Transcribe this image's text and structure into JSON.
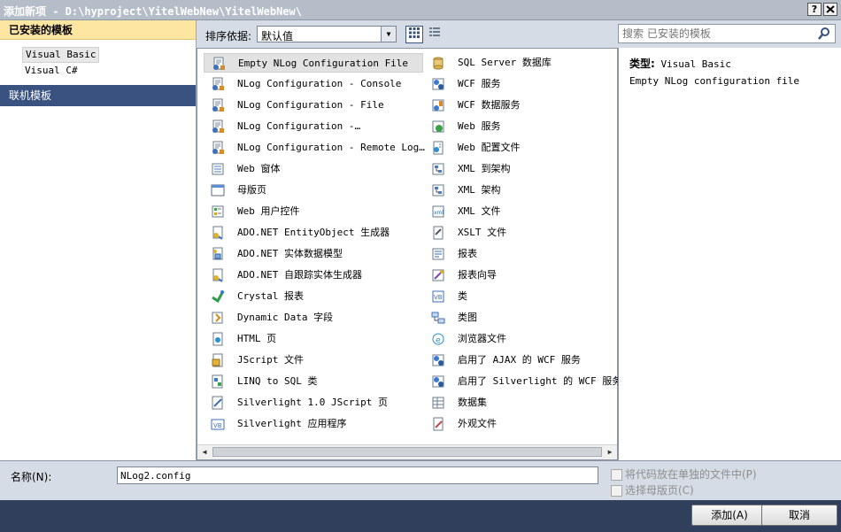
{
  "window": {
    "title": "添加新项 - D:\\hyproject\\YitelWebNew\\YitelWebNew\\",
    "help_btn": "?",
    "close_btn": "X"
  },
  "sidebar": {
    "installed_header": "已安装的模板",
    "items": [
      {
        "label": "Visual Basic",
        "selected": true
      },
      {
        "label": "Visual C#",
        "selected": false
      }
    ],
    "online_header": "联机模板"
  },
  "toolbar": {
    "sort_label": "排序依据:",
    "sort_value": "默认值",
    "search_placeholder": "搜索 已安装的模板"
  },
  "templates_left": [
    {
      "label": "Empty NLog Configuration File",
      "icon": "nlog-config-icon",
      "selected": true
    },
    {
      "label": "NLog Configuration - Console",
      "icon": "nlog-config-icon"
    },
    {
      "label": "NLog Configuration - File",
      "icon": "nlog-config-icon"
    },
    {
      "label": "NLog Configuration -…",
      "icon": "nlog-config-icon"
    },
    {
      "label": "NLog Configuration - Remote Log…",
      "icon": "nlog-config-icon"
    },
    {
      "label": "Web 窗体",
      "icon": "web-form-icon"
    },
    {
      "label": "母版页",
      "icon": "master-page-icon"
    },
    {
      "label": "Web 用户控件",
      "icon": "user-control-icon"
    },
    {
      "label": "ADO.NET EntityObject 生成器",
      "icon": "entity-generator-icon"
    },
    {
      "label": "ADO.NET 实体数据模型",
      "icon": "entity-model-icon"
    },
    {
      "label": "ADO.NET 自跟踪实体生成器",
      "icon": "entity-generator-icon"
    },
    {
      "label": "Crystal 报表",
      "icon": "crystal-report-icon"
    },
    {
      "label": "Dynamic Data 字段",
      "icon": "dynamic-data-icon"
    },
    {
      "label": "HTML 页",
      "icon": "html-page-icon"
    },
    {
      "label": "JScript 文件",
      "icon": "jscript-file-icon"
    },
    {
      "label": "LINQ to SQL 类",
      "icon": "linq-sql-icon"
    },
    {
      "label": "Silverlight 1.0 JScript 页",
      "icon": "silverlight-page-icon"
    },
    {
      "label": "Silverlight 应用程序",
      "icon": "silverlight-app-icon"
    }
  ],
  "templates_right": [
    {
      "label": "SQL Server 数据库",
      "icon": "database-icon"
    },
    {
      "label": "WCF 服务",
      "icon": "wcf-service-icon"
    },
    {
      "label": "WCF 数据服务",
      "icon": "wcf-data-service-icon"
    },
    {
      "label": "Web 服务",
      "icon": "web-service-icon"
    },
    {
      "label": "Web 配置文件",
      "icon": "web-config-icon"
    },
    {
      "label": "XML 到架构",
      "icon": "xml-schema-icon"
    },
    {
      "label": "XML 架构",
      "icon": "xml-schema-icon"
    },
    {
      "label": "XML 文件",
      "icon": "xml-file-icon"
    },
    {
      "label": "XSLT 文件",
      "icon": "xslt-file-icon"
    },
    {
      "label": "报表",
      "icon": "report-icon"
    },
    {
      "label": "报表向导",
      "icon": "report-wizard-icon"
    },
    {
      "label": "类",
      "icon": "class-icon"
    },
    {
      "label": "类图",
      "icon": "class-diagram-icon"
    },
    {
      "label": "浏览器文件",
      "icon": "browser-file-icon"
    },
    {
      "label": "启用了 AJAX 的 WCF 服务",
      "icon": "wcf-service-icon"
    },
    {
      "label": "启用了 Silverlight 的 WCF 服务",
      "icon": "wcf-service-icon"
    },
    {
      "label": "数据集",
      "icon": "dataset-icon"
    },
    {
      "label": "外观文件",
      "icon": "skin-file-icon"
    }
  ],
  "detail": {
    "type_label": "类型:",
    "type_value": "Visual Basic",
    "description": "Empty NLog configuration file"
  },
  "name_field": {
    "label": "名称(N):",
    "value": "NLog2.config"
  },
  "options": [
    {
      "label": "将代码放在单独的文件中(P)",
      "enabled": false,
      "checked": false
    },
    {
      "label": "选择母版页(C)",
      "enabled": false,
      "checked": false
    }
  ],
  "buttons": {
    "add": "添加(A)",
    "cancel": "取消"
  },
  "colors": {
    "selected_sidebar": "#fde6a2",
    "online_header": "#3a5280",
    "bottom_bar": "#2f3f5c"
  }
}
